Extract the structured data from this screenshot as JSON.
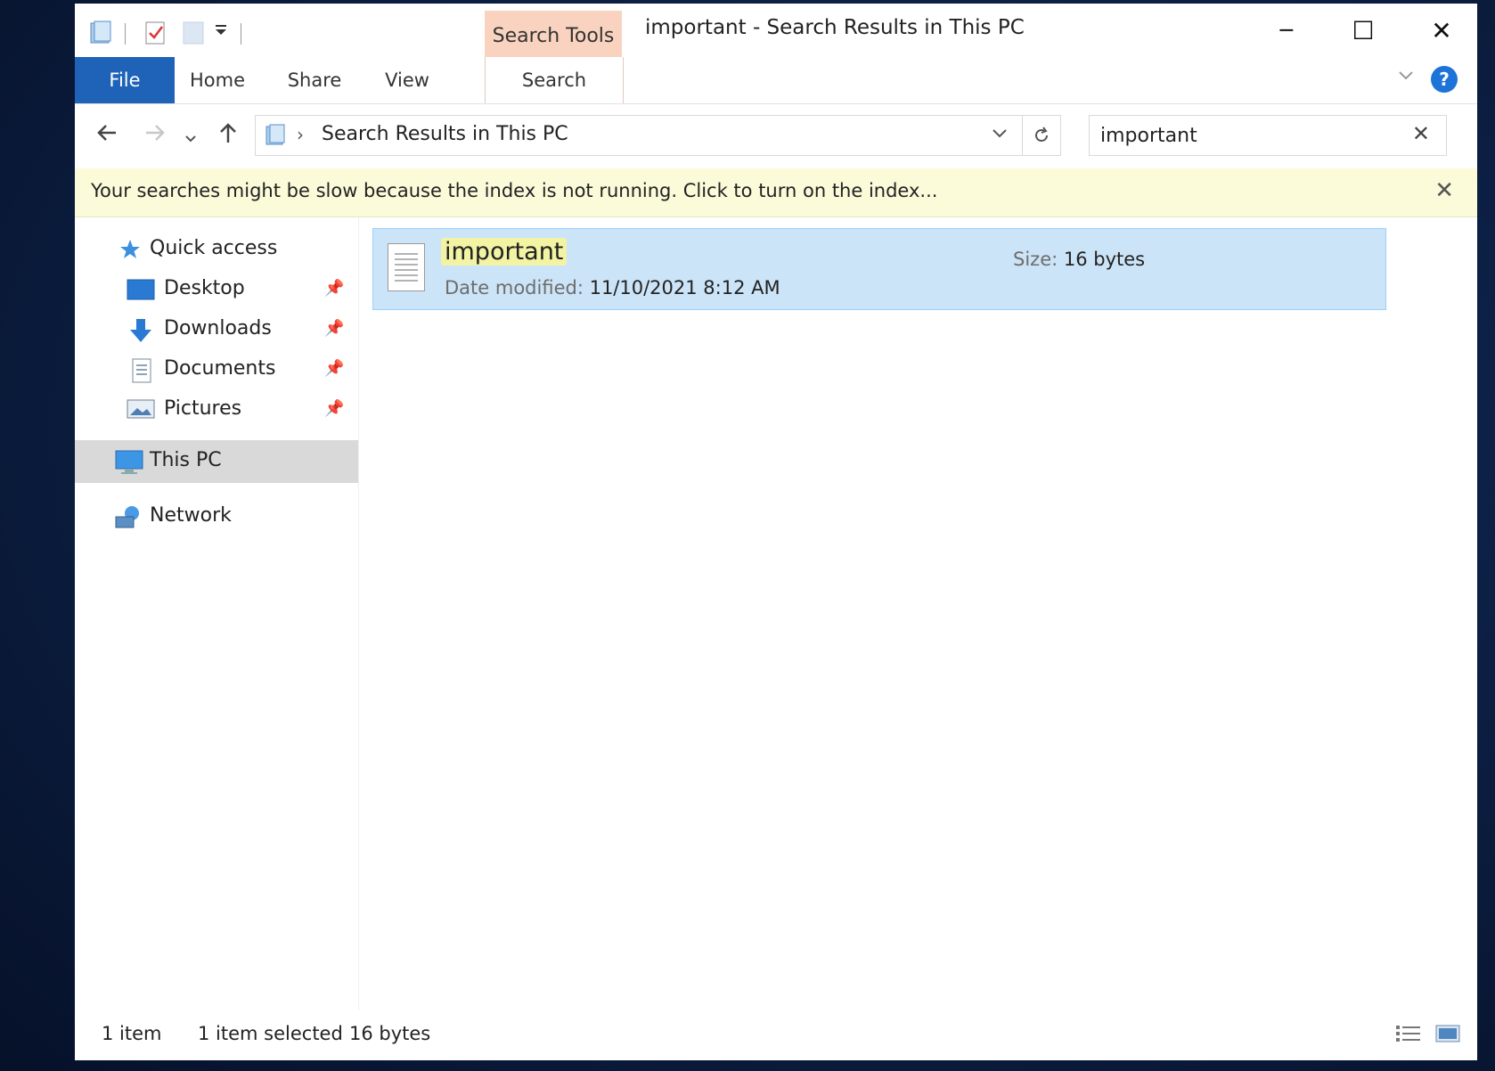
{
  "window": {
    "title": "important - Search Results in This PC",
    "context_tab_group": "Search Tools",
    "controls": {
      "minimize": "─",
      "maximize": "☐",
      "close": "✕"
    }
  },
  "ribbon": {
    "tabs": [
      {
        "label": "File"
      },
      {
        "label": "Home"
      },
      {
        "label": "Share"
      },
      {
        "label": "View"
      },
      {
        "label": "Search"
      }
    ],
    "help_label": "?"
  },
  "address_bar": {
    "path": "Search Results in This PC",
    "search_value": "important"
  },
  "info_bar": {
    "message": "Your searches might be slow because the index is not running.  Click to turn on the index..."
  },
  "nav_pane": {
    "items": [
      {
        "label": "Quick access",
        "icon": "star-icon"
      },
      {
        "label": "Desktop",
        "icon": "desktop-icon",
        "pinned": true
      },
      {
        "label": "Downloads",
        "icon": "download-arrow-icon",
        "pinned": true
      },
      {
        "label": "Documents",
        "icon": "documents-icon",
        "pinned": true
      },
      {
        "label": "Pictures",
        "icon": "pictures-icon",
        "pinned": true
      },
      {
        "label": "This PC",
        "icon": "computer-icon",
        "selected": true
      },
      {
        "label": "Network",
        "icon": "network-icon"
      }
    ]
  },
  "results": [
    {
      "name": "important",
      "date_label": "Date modified:",
      "date_value": "11/10/2021 8:12 AM",
      "size_label": "Size:",
      "size_value": "16 bytes"
    }
  ],
  "status_bar": {
    "item_count": "1 item",
    "selection": "1 item selected",
    "selection_size": "16 bytes"
  },
  "colors": {
    "file_tab": "#1e63b8",
    "context_tab": "#f9d3bf",
    "selection": "#cce4f7",
    "info_bar": "#fbfad9"
  }
}
